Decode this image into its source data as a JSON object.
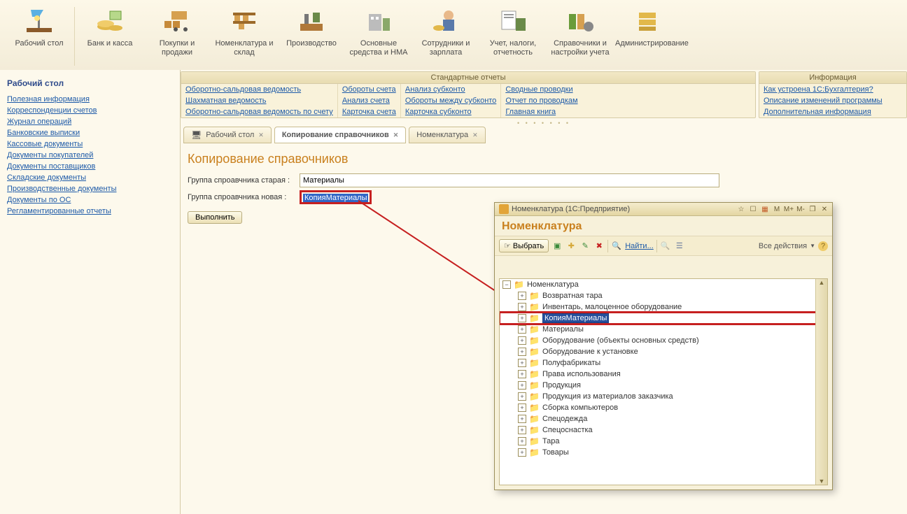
{
  "ribbon": [
    {
      "label": "Рабочий стол"
    },
    {
      "label": "Банк и касса"
    },
    {
      "label": "Покупки и продажи"
    },
    {
      "label": "Номенклатура и склад"
    },
    {
      "label": "Производство"
    },
    {
      "label": "Основные средства и НМА"
    },
    {
      "label": "Сотрудники и зарплата"
    },
    {
      "label": "Учет, налоги, отчетность"
    },
    {
      "label": "Справочники и настройки учета"
    },
    {
      "label": "Администрирование"
    }
  ],
  "sidebar_title": "Рабочий стол",
  "sidebar_links": [
    "Полезная информация",
    "Корреспонденции счетов",
    "Журнал операций",
    "Банковские выписки",
    "Кассовые документы",
    "Документы покупателей",
    "Документы поставщиков",
    "Складские документы",
    "Производственные документы",
    "Документы по ОС",
    "Регламентированные отчеты"
  ],
  "panel_reports_title": "Стандартные отчеты",
  "panel_reports": [
    [
      "Оборотно-сальдовая ведомость",
      "Шахматная ведомость",
      "Оборотно-сальдовая ведомость по счету"
    ],
    [
      "Обороты счета",
      "Анализ счета",
      "Карточка счета"
    ],
    [
      "Анализ субконто",
      "Обороты между субконто",
      "Карточка субконто"
    ],
    [
      "Сводные проводки",
      "Отчет по проводкам",
      "Главная книга"
    ]
  ],
  "panel_info_title": "Информация",
  "panel_info": [
    "Как устроена 1С:Бухгалтерия?",
    "Описание изменений программы",
    "Дополнительная информация"
  ],
  "tabs": [
    {
      "label": "Рабочий стол",
      "closable": true
    },
    {
      "label": "Копирование справочников",
      "closable": true,
      "active": true
    },
    {
      "label": "Номенклатура",
      "closable": true
    }
  ],
  "page_title": "Копирование справочников",
  "form": {
    "old_label": "Группа спроавчника старая :",
    "old_value": "Материалы",
    "new_label": "Группа спроавчника новая :",
    "new_value": "КопияМатериалы",
    "execute": "Выполнить"
  },
  "dialog": {
    "title": "Номенклатура  (1С:Предприятие)",
    "heading": "Номенклатура",
    "select_btn": "Выбрать",
    "find_label": "Найти...",
    "all_actions": "Все действия",
    "titlebar_btns": [
      "M",
      "M+",
      "M-"
    ],
    "tree": [
      {
        "d": 1,
        "exp": "minus",
        "label": "Номенклатура"
      },
      {
        "d": 2,
        "exp": "plus",
        "label": "Возвратная тара"
      },
      {
        "d": 2,
        "exp": "plus",
        "label": "Инвентарь, малоценное оборудование"
      },
      {
        "d": 2,
        "exp": "plus",
        "label": "КопияМатериалы",
        "selected": true
      },
      {
        "d": 2,
        "exp": "plus",
        "label": "Материалы"
      },
      {
        "d": 2,
        "exp": "plus",
        "label": "Оборудование (объекты основных средств)"
      },
      {
        "d": 2,
        "exp": "plus",
        "label": "Оборудование к установке"
      },
      {
        "d": 2,
        "exp": "plus",
        "label": "Полуфабрикаты"
      },
      {
        "d": 2,
        "exp": "plus",
        "label": "Права использования"
      },
      {
        "d": 2,
        "exp": "plus",
        "label": "Продукция"
      },
      {
        "d": 2,
        "exp": "plus",
        "label": "Продукция из материалов заказчика"
      },
      {
        "d": 2,
        "exp": "plus",
        "label": "Сборка компьютеров"
      },
      {
        "d": 2,
        "exp": "plus",
        "label": "Спецодежда"
      },
      {
        "d": 2,
        "exp": "plus",
        "label": "Спецоснастка"
      },
      {
        "d": 2,
        "exp": "plus",
        "label": "Тара"
      },
      {
        "d": 2,
        "exp": "plus",
        "label": "Товары"
      }
    ]
  }
}
